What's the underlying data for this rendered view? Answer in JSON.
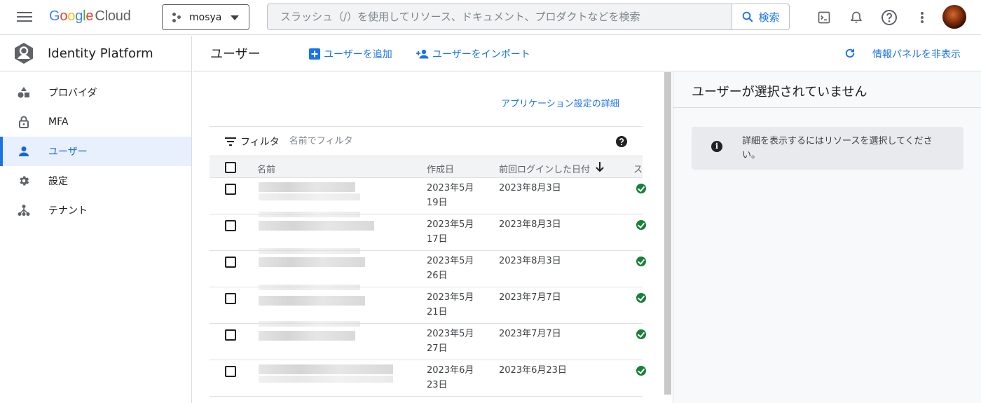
{
  "header": {
    "logo_google": "Google",
    "logo_cloud": "Cloud",
    "project_name": "mosya",
    "search_placeholder": "スラッシュ（/）を使用してリソース、ドキュメント、プロダクトなどを検索",
    "search_button": "検索"
  },
  "sidebar": {
    "product_title": "Identity Platform",
    "items": [
      {
        "label": "プロバイダ",
        "icon": "shapes-icon"
      },
      {
        "label": "MFA",
        "icon": "lock-icon"
      },
      {
        "label": "ユーザー",
        "icon": "person-icon",
        "active": true
      },
      {
        "label": "設定",
        "icon": "gear-icon"
      },
      {
        "label": "テナント",
        "icon": "tenant-icon"
      }
    ]
  },
  "toolbar": {
    "page_title": "ユーザー",
    "add_user": "ユーザーを追加",
    "import_users": "ユーザーをインポート",
    "hide_info_panel": "情報パネルを非表示"
  },
  "content": {
    "app_settings_link": "アプリケーション設定の詳細",
    "filter_label": "フィルタ",
    "filter_placeholder": "名前でフィルタ",
    "columns": {
      "name": "名前",
      "created": "作成日",
      "last_login": "前回ログインした日付",
      "status": "ス"
    },
    "rows": [
      {
        "created_l1": "2023年5月",
        "created_l2": "19日",
        "last_login": "2023年8月3日",
        "status": "enabled"
      },
      {
        "created_l1": "2023年5月",
        "created_l2": "17日",
        "last_login": "2023年8月3日",
        "status": "enabled"
      },
      {
        "created_l1": "2023年5月",
        "created_l2": "26日",
        "last_login": "2023年8月3日",
        "status": "enabled"
      },
      {
        "created_l1": "2023年5月",
        "created_l2": "21日",
        "last_login": "2023年7月7日",
        "status": "enabled"
      },
      {
        "created_l1": "2023年5月",
        "created_l2": "27日",
        "last_login": "2023年7月7日",
        "status": "enabled"
      },
      {
        "created_l1": "2023年6月",
        "created_l2": "23日",
        "last_login": "2023年6月23日",
        "status": "enabled"
      }
    ]
  },
  "info_panel": {
    "title": "ユーザーが選択されていません",
    "message": "詳細を表示するにはリソースを選択してください。"
  },
  "colors": {
    "accent": "#1a73e8",
    "status_ok": "#188038",
    "active_nav_bg": "#e8f0fe"
  }
}
